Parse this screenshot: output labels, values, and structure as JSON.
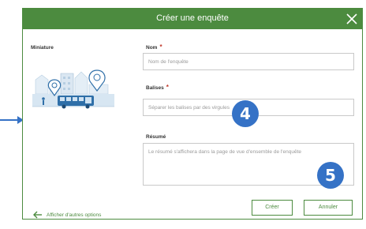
{
  "dialog": {
    "title": "Créer une enquête",
    "close_icon": "close-icon"
  },
  "thumbnail": {
    "label": "Miniature"
  },
  "fields": {
    "name": {
      "label": "Nom",
      "required": "*",
      "placeholder": "Nom de l'enquête"
    },
    "tags": {
      "label": "Balises",
      "required": "*",
      "placeholder": "Séparer les balises par des virgules"
    },
    "summary": {
      "label": "Résumé",
      "placeholder": "Le résumé s'affichera dans la page de vue d'ensemble de l'enquête"
    }
  },
  "buttons": {
    "create": "Créer",
    "cancel": "Annuler"
  },
  "more_options": {
    "label": "Afficher d'autres options",
    "icon": "arrow-left-icon"
  },
  "annotations": {
    "step4": "4",
    "step5": "5"
  },
  "colors": {
    "accent": "#4c8b3f",
    "badge": "#3572c6",
    "required": "#c0392b"
  }
}
